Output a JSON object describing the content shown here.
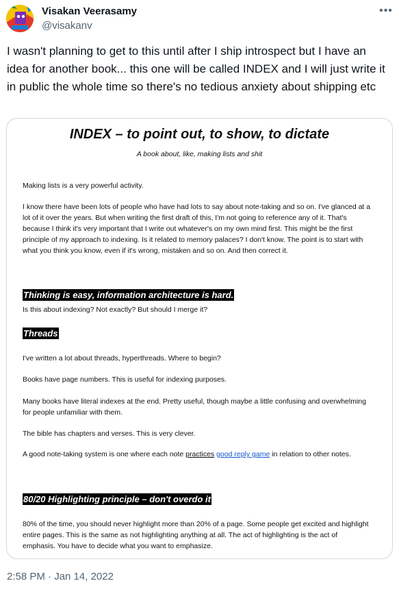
{
  "user": {
    "name": "Visakan Veerasamy",
    "handle": "@visakanv"
  },
  "tweet": {
    "text": "I wasn't planning to get to this until after I ship introspect but I have an idea for another book... this one will be called INDEX and I will just write it in public the whole time so there's no tedious anxiety about shipping etc",
    "timestamp": "2:58 PM · Jan 14, 2022"
  },
  "more_icon": "more-horizontal-icon",
  "document": {
    "title": "INDEX – to point out, to show, to dictate",
    "subtitle": "A book about, like, making lists and shit",
    "p1": "Making lists is a very powerful activity.",
    "p2": "I know there have been lots of people who have had lots to say about note-taking and so on. I've glanced at a lot of it over the years. But when writing the first draft of this, I'm not going to reference any of it. That's because I think it's very important that I write out whatever's on my own mind first. This might be the first principle of my approach to indexing. Is it related to memory palaces? I don't know. The point is to start with what you think you know, even if it's wrong, mistaken and so on. And then correct it.",
    "h1": "Thinking is easy, information architecture is hard.",
    "p3": "Is this about indexing? Not exactly? But should I merge it?",
    "h2": "Threads",
    "p4": "I've written a lot about threads, hyperthreads. Where to begin?",
    "p5": "Books have page numbers. This is useful for indexing purposes.",
    "p6": "Many books have literal indexes at the end. Pretty useful, though maybe a little confusing and overwhelming for people unfamiliar with them.",
    "p7": "The bible has chapters and verses. This is very clever.",
    "p8_a": "A good note-taking system is one where each note ",
    "p8_link1": "practices",
    "p8_space": " ",
    "p8_link2": "good reply game",
    "p8_b": " in relation to other notes.",
    "h3": "80/20 Highlighting principle – don't overdo it",
    "p9": "80% of the time, you should never highlight more than 20% of a page. Some people get excited and highlight entire pages. This is the same as not highlighting anything at all. The act of highlighting is the act of emphasis. You have to decide what you want to emphasize."
  }
}
